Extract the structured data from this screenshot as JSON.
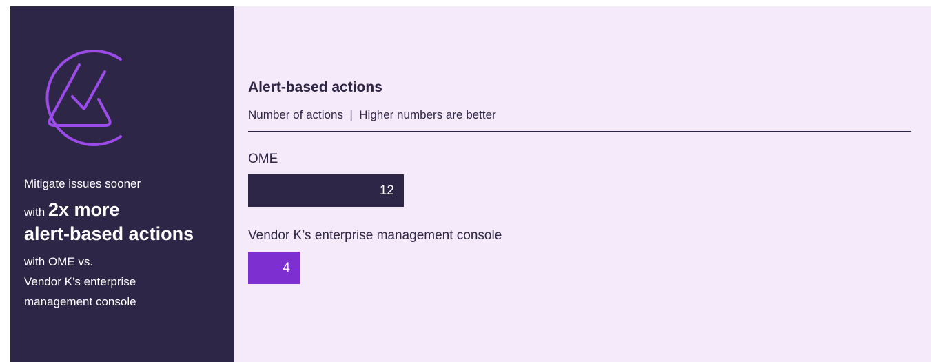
{
  "sidebar": {
    "lead": "Mitigate issues sooner",
    "with_word": "with",
    "highlight_line1": "2x more",
    "highlight_line2": "alert-based actions",
    "after_lines": [
      "with OME vs.",
      "Vendor K’s enterprise",
      "management console"
    ],
    "logo_icon": "check-triangle-circle-icon"
  },
  "colors": {
    "sidebar_bg": "#2d2646",
    "panel_bg": "#f4eafa",
    "ome_bar": "#2d2646",
    "vendor_bar": "#7e2fd0",
    "logo_stroke": "#9b4be8"
  },
  "chart_data": {
    "type": "bar",
    "orientation": "horizontal",
    "title": "Alert-based actions",
    "subtitle": "Number of actions  |  Higher numbers are better",
    "categories": [
      "OME",
      "Vendor K’s enterprise management console"
    ],
    "values": [
      12,
      4
    ],
    "value_labels": [
      "12",
      "4"
    ],
    "grid": false
  }
}
